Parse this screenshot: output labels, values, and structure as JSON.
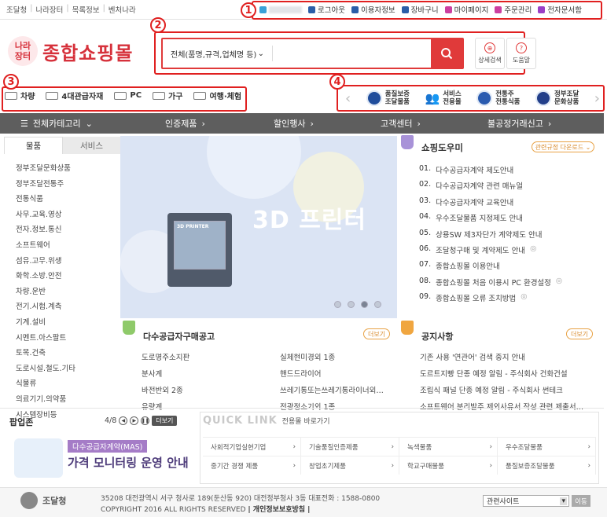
{
  "top_nav": [
    "조달청",
    "나라장터",
    "목록정보",
    "벤처나라"
  ],
  "utils": [
    {
      "label": "로그아웃",
      "color": "#2b5ea8",
      "icon": "logout-icon"
    },
    {
      "label": "이용자정보",
      "color": "#2b5ea8",
      "icon": "user-icon"
    },
    {
      "label": "장바구니",
      "color": "#2b5ea8",
      "icon": "cart-icon"
    },
    {
      "label": "마이페이지",
      "color": "#cc3fa0",
      "icon": "mypage-icon"
    },
    {
      "label": "주문관리",
      "color": "#cc3fa0",
      "icon": "order-icon"
    },
    {
      "label": "전자문서함",
      "color": "#9a3fc6",
      "icon": "document-icon"
    }
  ],
  "markers": [
    "1",
    "2",
    "3",
    "4"
  ],
  "logo": {
    "mark": "나라\n장터",
    "text": "종합쇼핑몰"
  },
  "search": {
    "select": "전체(품명,규격,업체명 등)",
    "value": "",
    "detail": "상세검색",
    "help": "도움말"
  },
  "quick_links": [
    "차량",
    "4대관급자재",
    "PC",
    "가구",
    "여행·체험"
  ],
  "featured": [
    {
      "label1": "품질보증",
      "label2": "조달물품"
    },
    {
      "label1": "서비스",
      "label2": "전용몰"
    },
    {
      "label1": "전통주",
      "label2": "전통식품"
    },
    {
      "label1": "정부조달",
      "label2": "문화상품"
    }
  ],
  "gnb": [
    "전체카테고리",
    "인증제품",
    "할인행사",
    "고객센터",
    "불공정거래신고"
  ],
  "tabs": [
    "물품",
    "서비스"
  ],
  "categories": [
    "정부조달문화상품",
    "정부조달전통주",
    "전통식품",
    "사무.교육.영상",
    "전자.정보.통신",
    "소프트웨어",
    "섬유.고무.위생",
    "화학.소방.안전",
    "차량.운반",
    "전기.시험.계측",
    "기계.설비",
    "시멘트.아스팔트",
    "토목.건축",
    "도로시설.철도.기타",
    "식물류",
    "의료기기.의약품",
    "시스템장비등"
  ],
  "banner": {
    "title": "3D 프린터",
    "printer_label": "3D PRINTER",
    "slide_count": 4,
    "active_slide": 3
  },
  "helper": {
    "title": "쇼핑도우미",
    "download": "관련규정 다운로드 ⌄",
    "items": [
      {
        "no": "01.",
        "text": "다수공급자계약 제도안내"
      },
      {
        "no": "02.",
        "text": "다수공급자계약 관련 매뉴얼"
      },
      {
        "no": "03.",
        "text": "다수공급자계약 교육안내"
      },
      {
        "no": "04.",
        "text": "우수조달물품 지정제도 안내"
      },
      {
        "no": "05.",
        "text": "상용SW 제3자단가 계약제도 안내"
      },
      {
        "no": "06.",
        "text": "조달청구매 및 계약제도 안내"
      },
      {
        "no": "07.",
        "text": "종합쇼핑몰 이용안내"
      },
      {
        "no": "08.",
        "text": "종합쇼핑몰 처음 이용시 PC 환경설정"
      },
      {
        "no": "09.",
        "text": "종합쇼핑몰 오류 조치방법"
      }
    ]
  },
  "mas_notice": {
    "title": "다수공급자구매공고",
    "more": "더보기",
    "col1": [
      "도로명주소지판",
      "분사계",
      "바전반외 2종",
      "유량계"
    ],
    "col2": [
      "실체현미경외 1종",
      "핸드드라이어",
      "쓰레기통또는쓰레기통라이너외…",
      "전광정소기외 1종"
    ]
  },
  "notice": {
    "title": "공지사항",
    "more": "더보기",
    "items": [
      "기존 사용 '연관어' 검색 중지 안내",
      "도르트지빵 단종 예정 알림 - 주식회사 건화건설",
      "조립식 패널 단종 예정 알림 - 주식회사 썬테크",
      "소프트웨어 분리발주 제외사유서 작성 관련 제출서…"
    ]
  },
  "popup_zone": {
    "title": "팝업존",
    "page": "4/8",
    "more": "더보기",
    "label": "다수공급자계약(MAS)",
    "headline": "가격 모니터링 운영 안내"
  },
  "quick_link": {
    "title": "QUICK LINK",
    "subtitle": "전용몰 바로가기",
    "items": [
      "사회적기업실현기업",
      "기술품질인증제품",
      "녹색물품",
      "우수조달물품",
      "중기간 경쟁 제품",
      "창업초기제품",
      "학교구매물품",
      "품질보증조달물품"
    ]
  },
  "footer": {
    "org": "조달청",
    "address": "35208 대전광역시 서구 청사로 189(둔산동 920) 대전정부청사 3동 대표전화 : 1588-0800",
    "copyright": "COPYRIGHT 2016 ALL RIGHTS RESERVED",
    "privacy": "| 개인정보보호방침 |",
    "select": "관련사이트",
    "go": "이동"
  },
  "colors": {
    "accent": "#e03a3a",
    "gnb": "#5e5e5e",
    "marker": "#e02020"
  }
}
